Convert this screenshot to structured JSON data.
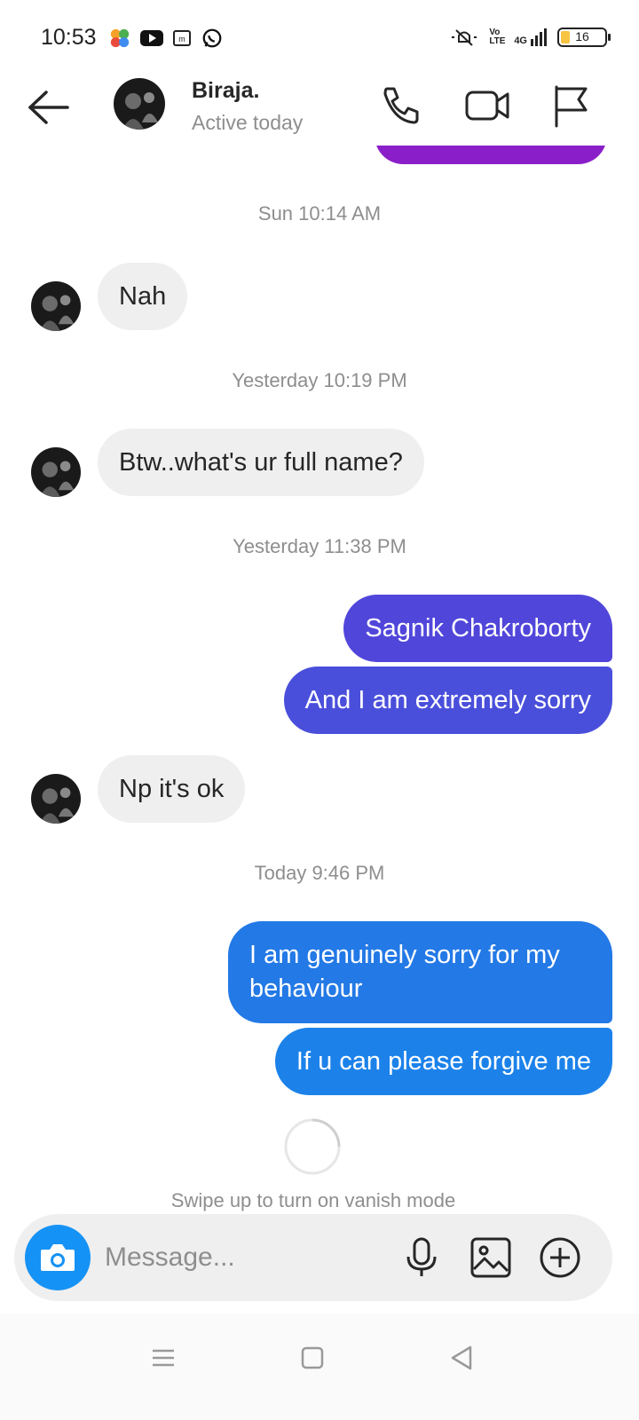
{
  "status_bar": {
    "time": "10:53",
    "network": "4G",
    "volte": "Vo LTE",
    "battery": "16",
    "icons": [
      "photos-app-icon",
      "youtube-icon",
      "messages-app-icon",
      "whatsapp-icon",
      "mute-icon",
      "volte-icon",
      "signal-icon",
      "battery-icon"
    ]
  },
  "header": {
    "contact_name": "Biraja.",
    "status": "Active today",
    "icons": [
      "back-arrow-icon",
      "phone-icon",
      "video-camera-icon",
      "flag-icon"
    ]
  },
  "colors": {
    "incoming_bubble": "#efefef",
    "outgoing_purple": "#8a1fc9",
    "outgoing_indigo": "#4a4fdb",
    "outgoing_blue": "#1f7ce8",
    "camera_button": "#1592f5",
    "timestamp": "#8e8e8e"
  },
  "conversation": {
    "ts1": "Sun 10:14 AM",
    "msg1": "Nah",
    "ts2": "Yesterday 10:19 PM",
    "msg2": "Btw..what's ur full name?",
    "ts3": "Yesterday 11:38 PM",
    "msg3": "Sagnik Chakroborty",
    "msg4": "And I am extremely sorry",
    "msg5": "Np it's ok",
    "ts4": "Today 9:46 PM",
    "msg6": "I am genuinely sorry for my behaviour",
    "msg7": "If u can please forgive me"
  },
  "vanish_hint": "Swipe up to turn on vanish mode",
  "composer": {
    "placeholder": "Message...",
    "icons": [
      "camera-icon",
      "microphone-icon",
      "gallery-icon",
      "add-icon"
    ]
  },
  "navbar": {
    "icons": [
      "menu-icon",
      "home-square-icon",
      "back-triangle-icon"
    ]
  }
}
